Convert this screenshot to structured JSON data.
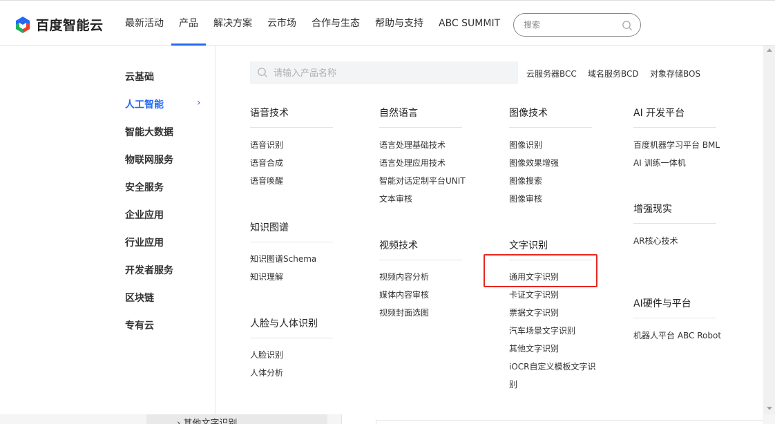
{
  "header": {
    "logo_text": "百度智能云",
    "nav": [
      "最新活动",
      "产品",
      "解决方案",
      "云市场",
      "合作与生态",
      "帮助与支持",
      "ABC SUMMIT"
    ],
    "active_nav_index": 1,
    "search_placeholder": "搜索"
  },
  "sidebar": {
    "items": [
      "云基础",
      "人工智能",
      "智能大数据",
      "物联网服务",
      "安全服务",
      "企业应用",
      "行业应用",
      "开发者服务",
      "区块链",
      "专有云"
    ],
    "active_index": 1,
    "chevron": "›"
  },
  "product_search": {
    "placeholder": "请输入产品名称",
    "quick_links": [
      "云服务器BCC",
      "域名服务BCD",
      "对象存储BOS"
    ]
  },
  "columns": {
    "speech": {
      "title": "语音技术",
      "items": [
        "语音识别",
        "语音合成",
        "语音唤醒"
      ]
    },
    "nlp": {
      "title": "自然语言",
      "items": [
        "语言处理基础技术",
        "语言处理应用技术",
        "智能对话定制平台UNIT",
        "文本审核"
      ]
    },
    "image": {
      "title": "图像技术",
      "items": [
        "图像识别",
        "图像效果增强",
        "图像搜索",
        "图像审核"
      ]
    },
    "aidev": {
      "title": "AI 开发平台",
      "items": [
        "百度机器学习平台 BML",
        "AI 训练一体机"
      ]
    },
    "kg": {
      "title": "知识图谱",
      "items": [
        "知识图谱Schema",
        "知识理解"
      ]
    },
    "video": {
      "title": "视频技术",
      "items": [
        "视频内容分析",
        "媒体内容审核",
        "视频封面选图"
      ]
    },
    "ocr": {
      "title": "文字识别",
      "items": [
        "通用文字识别",
        "卡证文字识别",
        "票据文字识别",
        "汽车场景文字识别",
        "其他文字识别",
        "iOCR自定义模板文字识",
        "别"
      ]
    },
    "ar": {
      "title": "增强现实",
      "items": [
        "AR核心技术"
      ]
    },
    "hw": {
      "title": "AI硬件与平台",
      "items": [
        "机器人平台 ABC Robot"
      ]
    },
    "face": {
      "title": "人脸与人体识别",
      "items": [
        "人脸识别",
        "人体分析"
      ]
    }
  },
  "underlying_page": {
    "visible_text": "› 其他文字识别"
  },
  "colors": {
    "accent": "#2468f2",
    "highlight": "#e8261e"
  }
}
